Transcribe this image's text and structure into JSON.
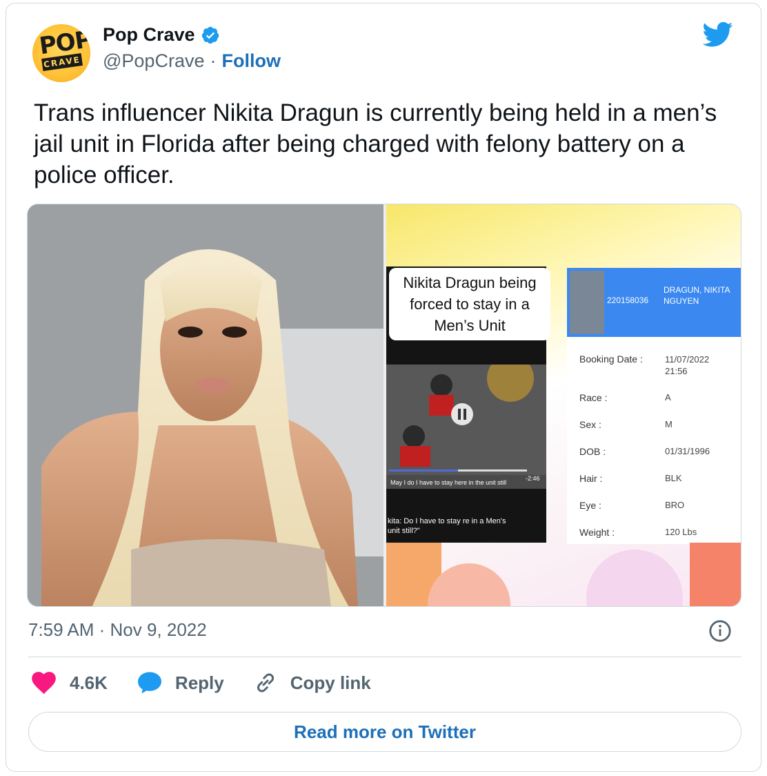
{
  "author": {
    "display_name": "Pop Crave",
    "handle": "@PopCrave",
    "separator": "·",
    "follow_label": "Follow",
    "avatar_text_top": "POP",
    "avatar_text_bottom": "CRAVE",
    "verified_icon": "verified-badge-icon"
  },
  "tweet": {
    "text": "Trans influencer Nikita Dragun is currently being held in a men’s jail unit in Florida after being charged with felony battery on a police officer.",
    "timestamp": "7:59 AM · Nov 9, 2022"
  },
  "media": {
    "right": {
      "overlay_title": "Nikita Dragun being forced to stay in a Men’s Unit",
      "caption_1": "May I do I have to stay here in the unit still",
      "caption_2": "kita: Do I have to stay re in a Men's unit still?\"",
      "duration": "-2:46",
      "booking_id": "220158036",
      "booking_name": "DRAGUN, NIKITA NGUYEN",
      "fields": [
        {
          "label": "Booking Date :",
          "value": "11/07/2022 21:56"
        },
        {
          "label": "Race :",
          "value": "A"
        },
        {
          "label": "Sex :",
          "value": "M"
        },
        {
          "label": "DOB :",
          "value": "01/31/1996"
        },
        {
          "label": "Hair :",
          "value": "BLK"
        },
        {
          "label": "Eye :",
          "value": "BRO"
        },
        {
          "label": "Weight :",
          "value": "120 Lbs"
        }
      ]
    }
  },
  "actions": {
    "like_count": "4.6K",
    "reply_label": "Reply",
    "copy_link_label": "Copy link"
  },
  "read_more_label": "Read more on Twitter",
  "colors": {
    "accent": "#1d6fb8",
    "like": "#f91880",
    "twitter_blue": "#1d9bf0",
    "muted": "#536471"
  }
}
